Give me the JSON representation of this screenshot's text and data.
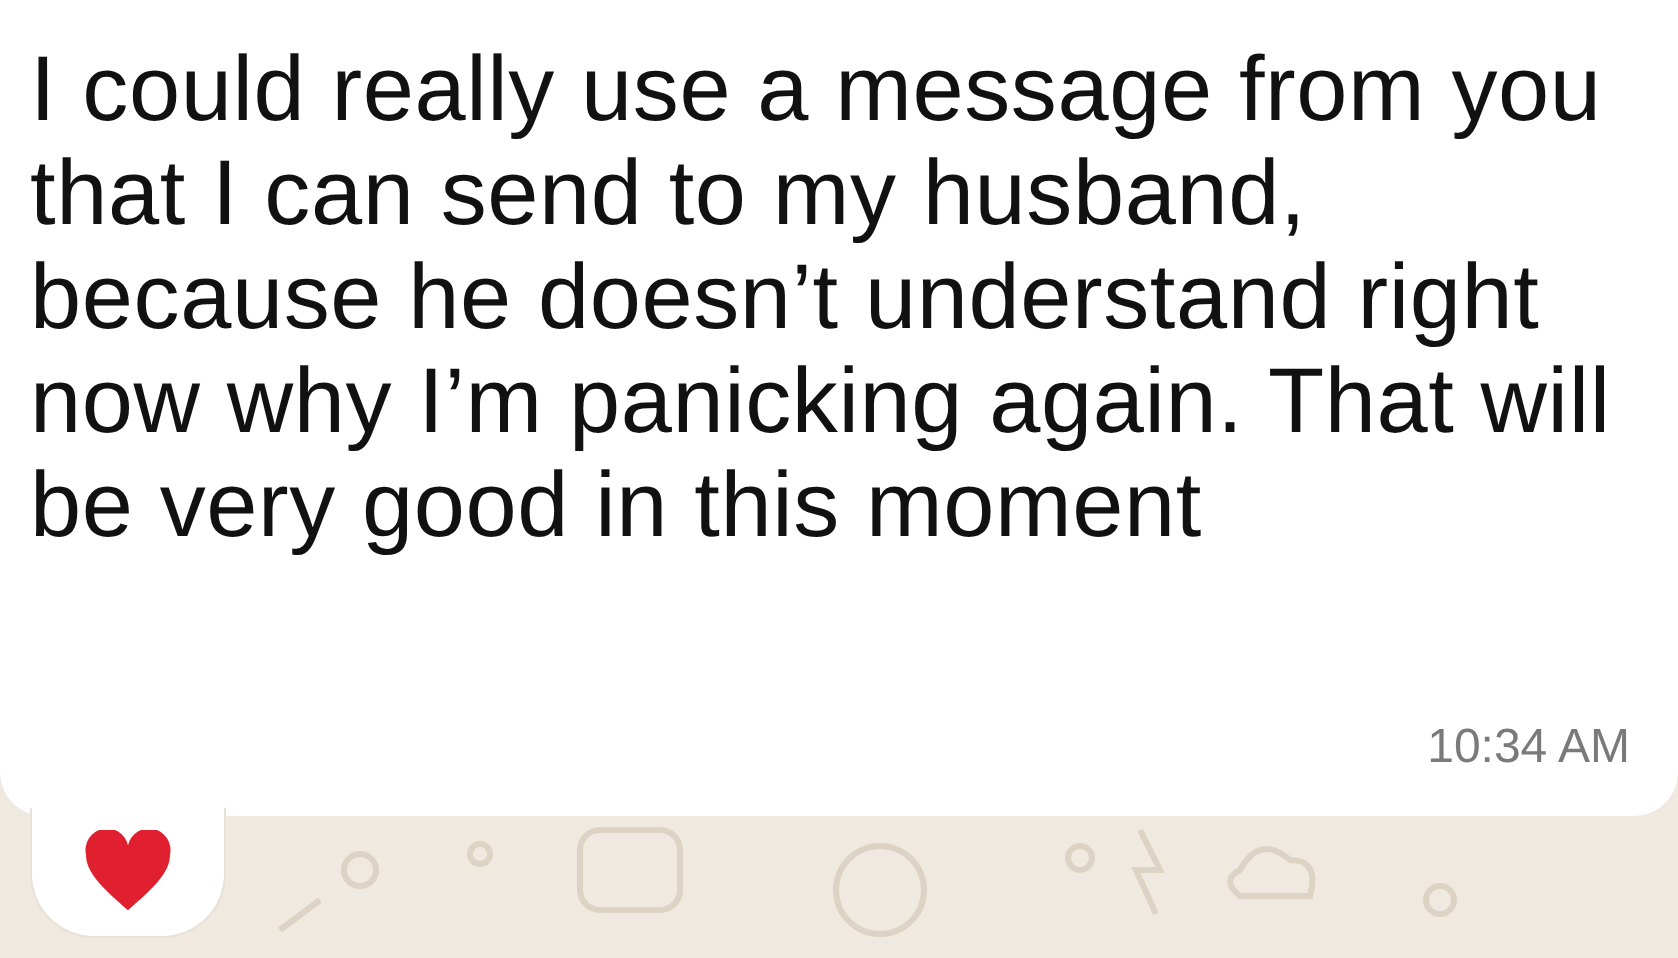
{
  "message": {
    "text": "I could really use a message from you that I can send to my husband, because he doesn’t understand right now why I’m panicking again. That will be very good in this moment",
    "time": "10:34 AM"
  }
}
